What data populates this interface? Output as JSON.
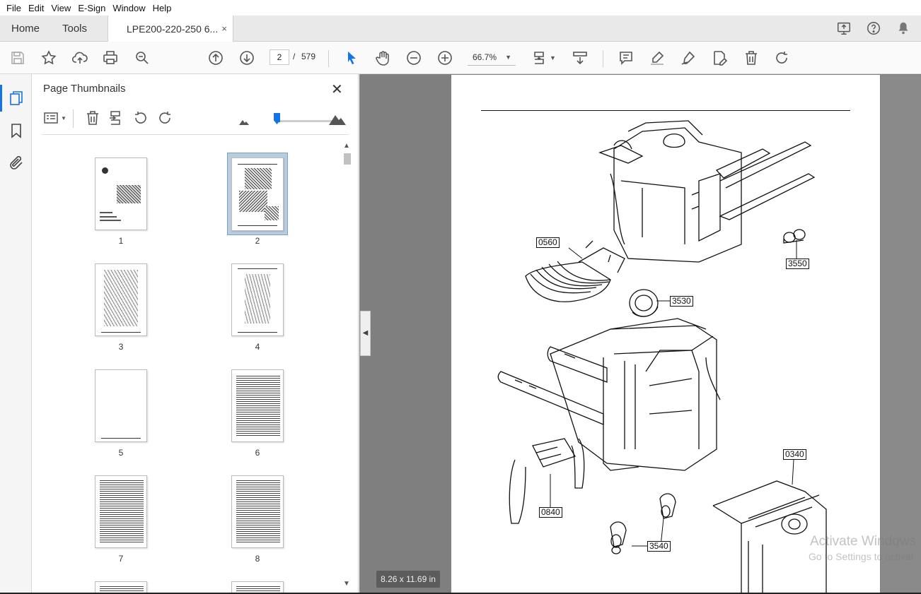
{
  "menu": [
    "File",
    "Edit",
    "View",
    "E-Sign",
    "Window",
    "Help"
  ],
  "tabs": {
    "home": "Home",
    "tools": "Tools",
    "document": "LPE200-220-250 6...",
    "close": "×"
  },
  "toolbar": {
    "current_page": "2",
    "page_sep": "/",
    "total_pages": "579",
    "zoom": "66.7%"
  },
  "panel": {
    "title": "Page Thumbnails",
    "close": "✕"
  },
  "thumbnails": [
    {
      "label": "1"
    },
    {
      "label": "2"
    },
    {
      "label": "3"
    },
    {
      "label": "4"
    },
    {
      "label": "5"
    },
    {
      "label": "6"
    },
    {
      "label": "7"
    },
    {
      "label": "8"
    }
  ],
  "document": {
    "page_size": "8.26 x 11.69 in",
    "callouts": [
      "0560",
      "3550",
      "3530",
      "0340",
      "0840",
      "3540"
    ],
    "watermark_line1": "Activate Windows",
    "watermark_line2": "Go to Settings to activat"
  },
  "colors": {
    "accent": "#1473e6",
    "canvas": "#7f7f7f"
  },
  "icons": [
    "save-icon",
    "star-icon",
    "upload-icon",
    "print-icon",
    "search-zoom-icon",
    "prev-page-icon",
    "next-page-icon",
    "select-arrow-icon",
    "hand-icon",
    "zoom-out-icon",
    "zoom-in-icon",
    "fit-page-icon",
    "scroll-mode-icon",
    "comment-icon",
    "highlight-icon",
    "sign-icon",
    "edit-pdf-icon",
    "delete-icon",
    "rotate-icon"
  ]
}
